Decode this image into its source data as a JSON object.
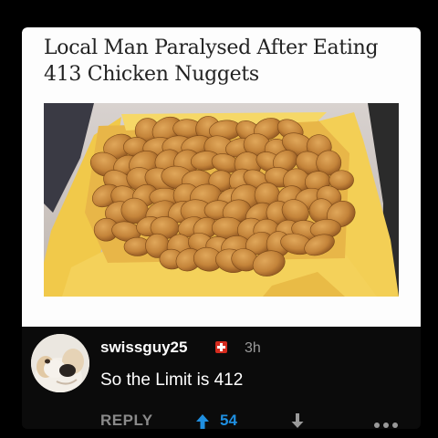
{
  "post": {
    "headline": "Local Man Paralysed After Eating 413 Chicken Nuggets",
    "image_alt": "box-of-chicken-nuggets-photo"
  },
  "comment": {
    "username": "swissguy25",
    "flag_icon": "swiss-flag-icon",
    "timestamp": "3h",
    "text": "So the Limit is 412",
    "reply_label": "REPLY",
    "vote_count": "54"
  },
  "colors": {
    "card_bg": "#fdfdfd",
    "comment_bg": "#0b0b0b",
    "vote_accent": "#1f8fe0",
    "flag_red": "#d52b1e",
    "nugget_gold": "#c98a3c",
    "box_yellow": "#f2cc4f"
  }
}
